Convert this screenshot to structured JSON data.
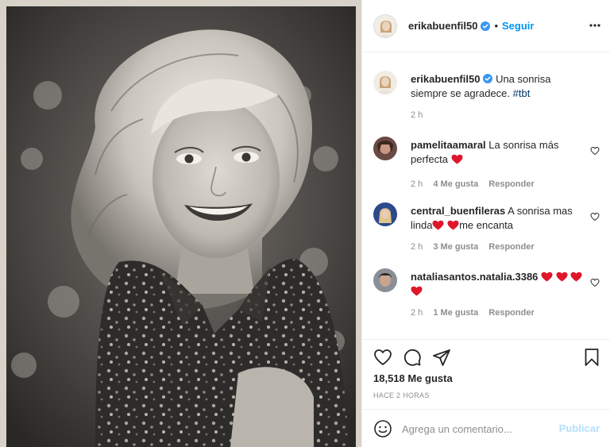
{
  "post": {
    "author": "erikabuenfil50",
    "follow_label": "Seguir",
    "dot": "•",
    "caption_text": "Una sonrisa siempre se agradece.",
    "caption_hashtag": "#tbt",
    "caption_time": "2 h"
  },
  "comments": [
    {
      "user": "pamelitaamaral",
      "text": "La sonrisa más perfecta",
      "time": "2 h",
      "likes": "4 Me gusta",
      "reply": "Responder"
    },
    {
      "user": "central_buenfileras",
      "text_a": "A sonrisa mas linda",
      "text_b": "me encanta",
      "time": "2 h",
      "likes": "3 Me gusta",
      "reply": "Responder"
    },
    {
      "user": "nataliasantos.natalia.3386",
      "time": "2 h",
      "likes": "1 Me gusta",
      "reply": "Responder"
    }
  ],
  "footer": {
    "like_count": "18,518 Me gusta",
    "posted_ago": "HACE 2 HORAS",
    "comment_placeholder": "Agrega un comentario...",
    "publish_label": "Publicar"
  },
  "colors": {
    "accent": "#0095f6",
    "heart_red": "#e0162b",
    "publish_disabled": "#b2dffc",
    "muted": "#8e8e8e"
  },
  "icons": [
    "verified-badge-icon",
    "more-options-icon",
    "heart-outline-icon",
    "comment-icon",
    "share-icon",
    "bookmark-icon",
    "emoji-icon",
    "red-heart-emoji"
  ]
}
